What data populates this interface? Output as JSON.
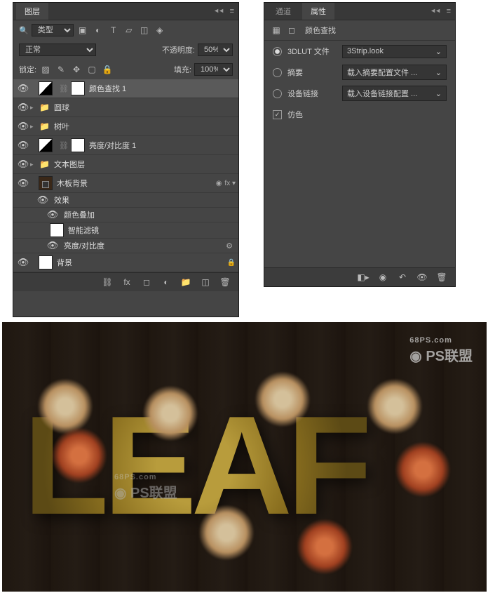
{
  "layers_panel": {
    "title": "图层",
    "filter_label": "类型",
    "blend_mode": "正常",
    "opacity_label": "不透明度:",
    "opacity_value": "50%",
    "lock_label": "锁定:",
    "fill_label": "填充:",
    "fill_value": "100%",
    "layers": [
      {
        "name": "颜色查找 1",
        "type": "adj",
        "selected": true,
        "indent": 0,
        "vis": true,
        "mask": true
      },
      {
        "name": "圆球",
        "type": "group",
        "indent": 0,
        "vis": true,
        "collapsed": true
      },
      {
        "name": "树叶",
        "type": "group",
        "indent": 0,
        "vis": true,
        "collapsed": true
      },
      {
        "name": "亮度/对比度 1",
        "type": "adj",
        "indent": 0,
        "vis": true,
        "mask": true
      },
      {
        "name": "文本图层",
        "type": "group",
        "indent": 0,
        "vis": true,
        "collapsed": true
      },
      {
        "name": "木板背景",
        "type": "smart",
        "indent": 0,
        "vis": true,
        "expanded": true,
        "fx": true
      },
      {
        "name": "效果",
        "type": "fx-header",
        "indent": 2,
        "vis": true
      },
      {
        "name": "颜色叠加",
        "type": "fx-item",
        "indent": 2,
        "vis": true
      },
      {
        "name": "智能滤镜",
        "type": "filter-header",
        "indent": 2,
        "thumb": true
      },
      {
        "name": "亮度/对比度",
        "type": "filter-item",
        "indent": 2,
        "vis": true
      },
      {
        "name": "背景",
        "type": "normal",
        "indent": 0,
        "vis": true,
        "locked": true
      }
    ]
  },
  "properties_panel": {
    "tab1": "通道",
    "tab2": "属性",
    "header": "颜色查找",
    "rows": [
      {
        "type": "radio",
        "checked": true,
        "label": "3DLUT 文件",
        "value": "3Strip.look"
      },
      {
        "type": "radio",
        "checked": false,
        "label": "摘要",
        "value": "载入摘要配置文件 ..."
      },
      {
        "type": "radio",
        "checked": false,
        "label": "设备链接",
        "value": "载入设备链接配置 ..."
      },
      {
        "type": "check",
        "checked": true,
        "label": "仿色"
      }
    ]
  },
  "preview": {
    "text": "LEAF",
    "watermark_url": "68PS.com",
    "watermark_name": "PS联盟"
  }
}
